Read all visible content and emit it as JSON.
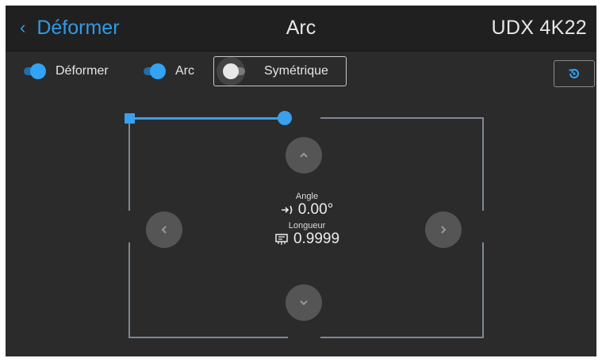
{
  "header": {
    "back_label": "Déformer",
    "title": "Arc",
    "model": "UDX 4K22"
  },
  "toolbar": {
    "toggles": [
      {
        "label": "Déformer",
        "state": "on"
      },
      {
        "label": "Arc",
        "state": "on"
      },
      {
        "label": "Symétrique",
        "state": "off"
      }
    ],
    "reset_icon": "reset-icon"
  },
  "readout": {
    "angle_label": "Angle",
    "angle_value": "0.00°",
    "length_label": "Longueur",
    "length_value": "0.9999"
  },
  "colors": {
    "accent": "#2f9be8",
    "background": "#2b2b2b",
    "header": "#202020"
  }
}
